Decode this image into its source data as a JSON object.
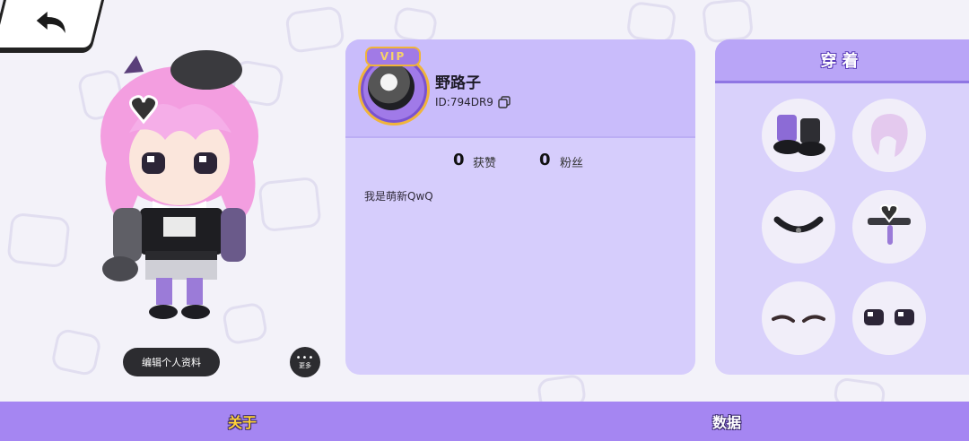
{
  "profile": {
    "vip_label": "VIP",
    "username": "野路子",
    "user_id": "ID:794DR9",
    "likes_count": "0",
    "likes_label": "获赞",
    "fans_count": "0",
    "fans_label": "粉丝",
    "bio": "我是萌新QwQ"
  },
  "actions": {
    "edit_profile_label": "编辑个人资料",
    "more_label": "更多",
    "more_dots": "•••"
  },
  "outfit": {
    "title": "穿着",
    "items": [
      "shoes-icon",
      "hair-icon",
      "choker-icon",
      "accessory-icon",
      "eyebrows-icon",
      "eyes-icon"
    ]
  },
  "tabs": {
    "about": "关于",
    "data": "数据"
  },
  "colors": {
    "accent": "#a586f2",
    "card": "#d6cdfc",
    "active_tab": "#ffd236"
  }
}
